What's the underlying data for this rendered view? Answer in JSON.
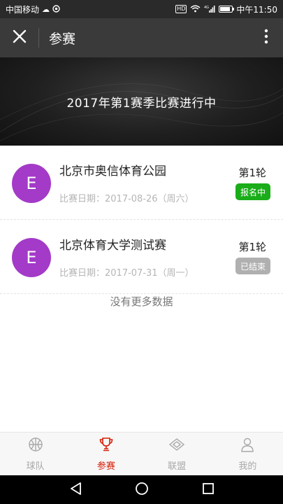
{
  "status_bar": {
    "carrier": "中国移动",
    "time": "中午11:50",
    "hd": "HD",
    "network": "4G",
    "battery_level": 0.85
  },
  "app_bar": {
    "title": "参赛",
    "close_icon": "close-icon",
    "more_icon": "more-vertical-icon"
  },
  "banner": {
    "title": "2017年第1赛季比赛进行中"
  },
  "matches": [
    {
      "avatar_letter": "E",
      "avatar_color": "#a33ac8",
      "venue": "北京市奥信体育公园",
      "date_label": "比赛日期：2017-08-26（周六）",
      "round": "第1轮",
      "status": "报名中",
      "status_color": "#1aad19"
    },
    {
      "avatar_letter": "E",
      "avatar_color": "#a33ac8",
      "venue": "北京体育大学测试赛",
      "date_label": "比赛日期：2017-07-31（周一）",
      "round": "第1轮",
      "status": "已结束",
      "status_color": "#b0b0b0"
    }
  ],
  "no_more_text": "没有更多数据",
  "tabs": [
    {
      "label": "球队",
      "icon": "basketball-icon",
      "active": false
    },
    {
      "label": "参赛",
      "icon": "trophy-icon",
      "active": true
    },
    {
      "label": "联盟",
      "icon": "diamond-icon",
      "active": false
    },
    {
      "label": "我的",
      "icon": "user-icon",
      "active": false
    }
  ],
  "colors": {
    "active_tab": "#d81e06",
    "inactive_tab": "#a8a8a8"
  }
}
